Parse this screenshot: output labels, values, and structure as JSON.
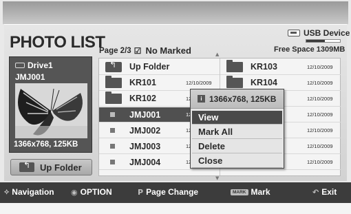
{
  "header": {
    "title": "PHOTO LIST",
    "page_indicator": "Page 2/3",
    "mark_status": "No Marked",
    "checkbox_glyph": "☑",
    "usb_label": "USB Device",
    "usb_usage_fraction": 0.55,
    "free_space": "Free Space 1309MB"
  },
  "preview": {
    "drive": "Drive1",
    "file_name": "JMJ001",
    "resolution": "1366x768, 125KB"
  },
  "up_folder_button": {
    "label": "Up Folder"
  },
  "list": {
    "left": [
      {
        "name": "Up Folder",
        "date": "",
        "type": "up"
      },
      {
        "name": "KR101",
        "date": "12/10/2009",
        "type": "folder"
      },
      {
        "name": "KR102",
        "date": "12/10/2009",
        "type": "folder"
      },
      {
        "name": "JMJ001",
        "date": "12/10/2009",
        "type": "file"
      },
      {
        "name": "JMJ002",
        "date": "12/10/2009",
        "type": "file"
      },
      {
        "name": "JMJ003",
        "date": "12/10/2009",
        "type": "file"
      },
      {
        "name": "JMJ004",
        "date": "12/10/2009",
        "type": "file"
      }
    ],
    "right": [
      {
        "name": "KR103",
        "date": "12/10/2009",
        "type": "folder"
      },
      {
        "name": "KR104",
        "date": "12/10/2009",
        "type": "folder"
      },
      {
        "name": "",
        "date": "12/10/2009",
        "type": "none"
      },
      {
        "name": "",
        "date": "12/10/2009",
        "type": "none"
      },
      {
        "name": "",
        "date": "12/10/2009",
        "type": "none"
      },
      {
        "name": "",
        "date": "12/10/2009",
        "type": "none"
      },
      {
        "name": "",
        "date": "12/10/2009",
        "type": "none"
      }
    ],
    "selected_index": 3
  },
  "popup": {
    "header": "1366x768, 125KB",
    "info_glyph": "i",
    "items": [
      "View",
      "Mark All",
      "Delete",
      "Close"
    ],
    "active_index": 0
  },
  "footer": {
    "navigation": "Navigation",
    "option": "OPTION",
    "page_change": "Page Change",
    "mark": "Mark",
    "mark_badge": "MARK",
    "exit": "Exit",
    "nav_glyph": "⟡",
    "option_glyph": "◉",
    "page_glyph": "P",
    "exit_glyph": "↶"
  }
}
